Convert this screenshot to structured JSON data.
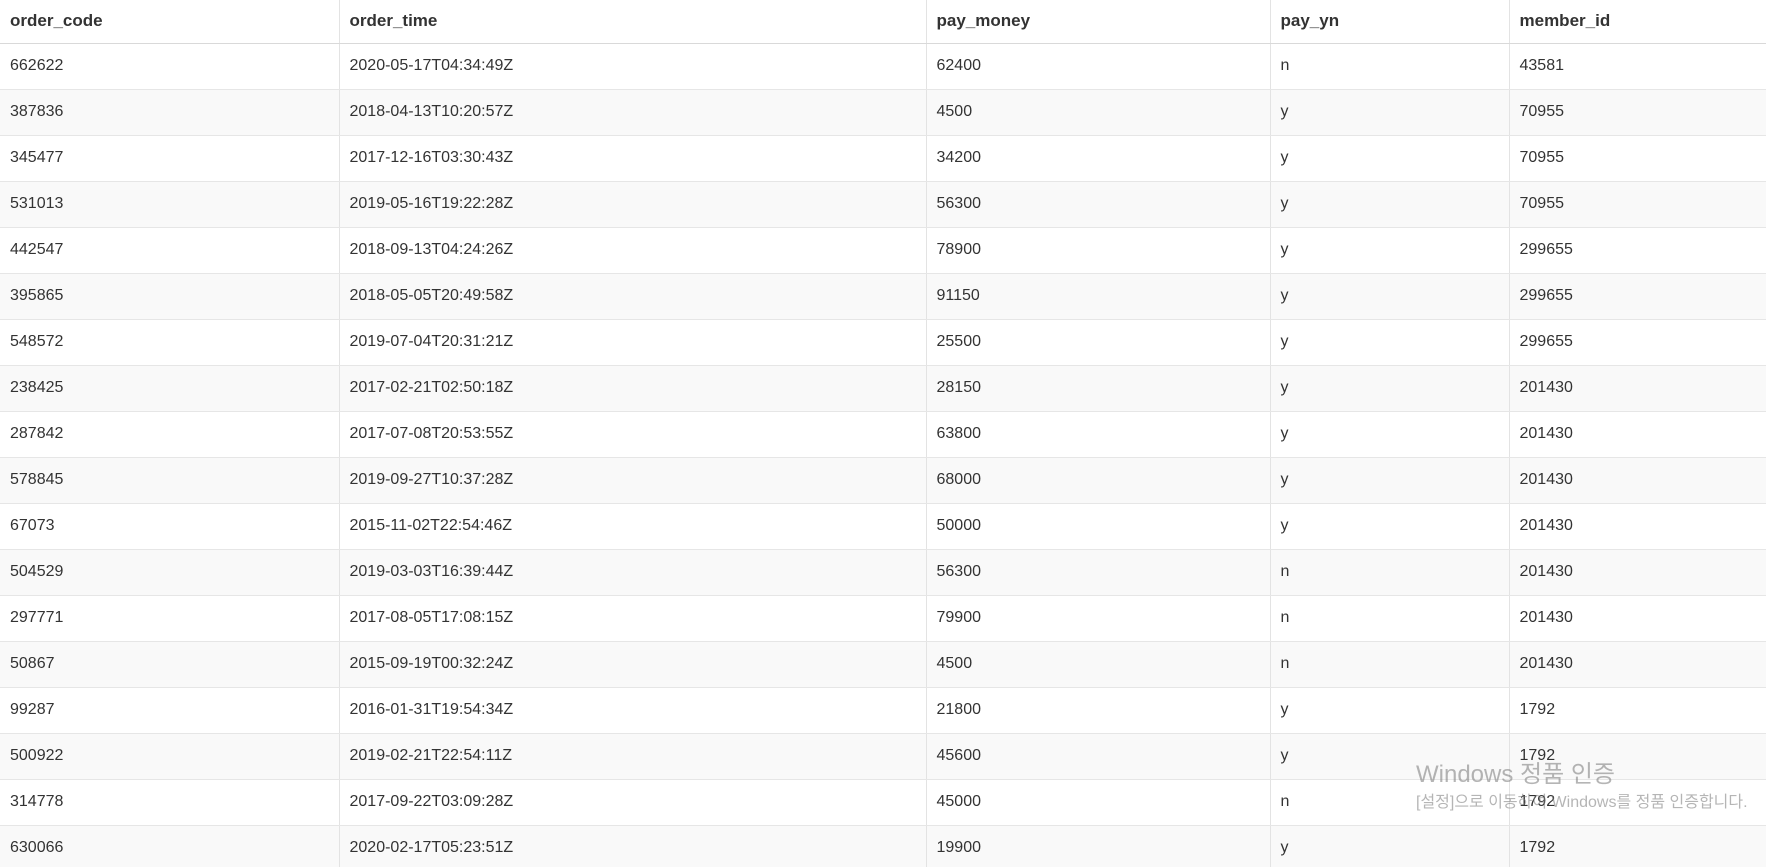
{
  "table": {
    "columns": [
      "order_code",
      "order_time",
      "pay_money",
      "pay_yn",
      "member_id"
    ],
    "rows": [
      [
        "662622",
        "2020-05-17T04:34:49Z",
        "62400",
        "n",
        "43581"
      ],
      [
        "387836",
        "2018-04-13T10:20:57Z",
        "4500",
        "y",
        "70955"
      ],
      [
        "345477",
        "2017-12-16T03:30:43Z",
        "34200",
        "y",
        "70955"
      ],
      [
        "531013",
        "2019-05-16T19:22:28Z",
        "56300",
        "y",
        "70955"
      ],
      [
        "442547",
        "2018-09-13T04:24:26Z",
        "78900",
        "y",
        "299655"
      ],
      [
        "395865",
        "2018-05-05T20:49:58Z",
        "91150",
        "y",
        "299655"
      ],
      [
        "548572",
        "2019-07-04T20:31:21Z",
        "25500",
        "y",
        "299655"
      ],
      [
        "238425",
        "2017-02-21T02:50:18Z",
        "28150",
        "y",
        "201430"
      ],
      [
        "287842",
        "2017-07-08T20:53:55Z",
        "63800",
        "y",
        "201430"
      ],
      [
        "578845",
        "2019-09-27T10:37:28Z",
        "68000",
        "y",
        "201430"
      ],
      [
        "67073",
        "2015-11-02T22:54:46Z",
        "50000",
        "y",
        "201430"
      ],
      [
        "504529",
        "2019-03-03T16:39:44Z",
        "56300",
        "n",
        "201430"
      ],
      [
        "297771",
        "2017-08-05T17:08:15Z",
        "79900",
        "n",
        "201430"
      ],
      [
        "50867",
        "2015-09-19T00:32:24Z",
        "4500",
        "n",
        "201430"
      ],
      [
        "99287",
        "2016-01-31T19:54:34Z",
        "21800",
        "y",
        "1792"
      ],
      [
        "500922",
        "2019-02-21T22:54:11Z",
        "45600",
        "y",
        "1792"
      ],
      [
        "314778",
        "2017-09-22T03:09:28Z",
        "45000",
        "n",
        "1792"
      ],
      [
        "630066",
        "2020-02-17T05:23:51Z",
        "19900",
        "y",
        "1792"
      ]
    ]
  },
  "watermark": {
    "title": "Windows 정품 인증",
    "subtitle": "[설정]으로 이동하여 Windows를 정품 인증합니다."
  }
}
